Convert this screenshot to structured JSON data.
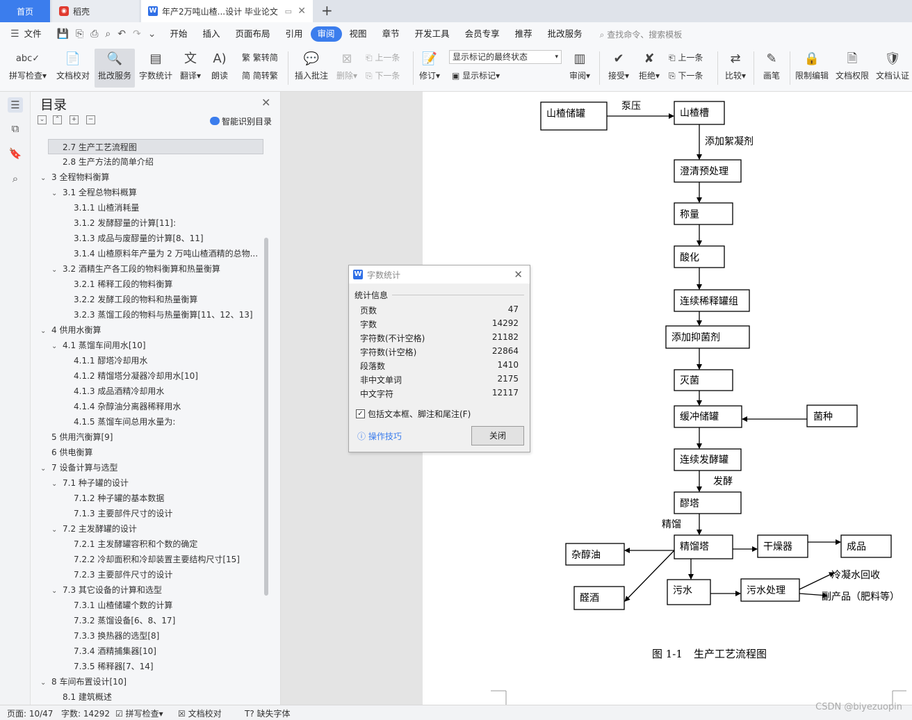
{
  "tabs": {
    "home": "首页",
    "daoke": "稻壳",
    "doc": "年产2万吨山楂...设计 毕业论文",
    "add": "+"
  },
  "menu": {
    "file": "文件",
    "items": [
      "开始",
      "插入",
      "页面布局",
      "引用",
      "审阅",
      "视图",
      "章节",
      "开发工具",
      "会员专享",
      "推荐",
      "批改服务"
    ],
    "active_index": 4,
    "search": "查找命令、搜索模板"
  },
  "ribbon": {
    "spell": "拼写检查",
    "proof": "文档校对",
    "grading": "批改服务",
    "wordcount": "字数统计",
    "translate": "翻译",
    "read": "朗读",
    "trad": "繁转简",
    "simp": "简转繁",
    "insert_comment": "插入批注",
    "delete": "删除",
    "prev": "上一条",
    "next": "下一条",
    "revise": "修订",
    "markup_state": "显示标记的最终状态",
    "show_markup": "显示标记",
    "review": "审阅",
    "accept": "接受",
    "reject": "拒绝",
    "prev2": "上一条",
    "next2": "下一条",
    "compare": "比较",
    "pen": "画笔",
    "restrict": "限制编辑",
    "permission": "文档权限",
    "certify": "文档认证"
  },
  "toc": {
    "title": "目录",
    "ai": "智能识别目录",
    "items": [
      {
        "text": "2.7 生产工艺流程图",
        "level": 2,
        "arrow": "",
        "selected": true
      },
      {
        "text": "2.8 生产方法的简单介绍",
        "level": 2,
        "arrow": ""
      },
      {
        "text": "3 全程物料衡算",
        "level": 1,
        "arrow": "v"
      },
      {
        "text": "3.1 全程总物料概算",
        "level": 2,
        "arrow": "v"
      },
      {
        "text": "3.1.1 山楂消耗量",
        "level": 3,
        "arrow": ""
      },
      {
        "text": "3.1.2 发酵醪量的计算[11]:",
        "level": 3,
        "arrow": ""
      },
      {
        "text": "3.1.3 成品与废醪量的计算[8、11]",
        "level": 3,
        "arrow": ""
      },
      {
        "text": "3.1.4 山楂原料年产量为 2 万吨山楂酒精的总物...",
        "level": 3,
        "arrow": ""
      },
      {
        "text": "3.2 酒精生产各工段的物料衡算和热量衡算",
        "level": 2,
        "arrow": "v"
      },
      {
        "text": "3.2.1 稀释工段的物料衡算",
        "level": 3,
        "arrow": ""
      },
      {
        "text": "3.2.2 发酵工段的物料和热量衡算",
        "level": 3,
        "arrow": ""
      },
      {
        "text": "3.2.3 蒸馏工段的物料与热量衡算[11、12、13]",
        "level": 3,
        "arrow": ""
      },
      {
        "text": "4 供用水衡算",
        "level": 1,
        "arrow": "v"
      },
      {
        "text": "4.1 蒸馏车间用水[10]",
        "level": 2,
        "arrow": "v"
      },
      {
        "text": "4.1.1 醪塔冷却用水",
        "level": 3,
        "arrow": ""
      },
      {
        "text": "4.1.2 精馏塔分凝器冷却用水[10]",
        "level": 3,
        "arrow": ""
      },
      {
        "text": "4.1.3 成品酒精冷却用水",
        "level": 3,
        "arrow": ""
      },
      {
        "text": "4.1.4 杂醇油分离器稀释用水",
        "level": 3,
        "arrow": ""
      },
      {
        "text": "4.1.5 蒸馏车间总用水量为:",
        "level": 3,
        "arrow": ""
      },
      {
        "text": "5 供用汽衡算[9]",
        "level": 1,
        "arrow": ""
      },
      {
        "text": "6 供电衡算",
        "level": 1,
        "arrow": ""
      },
      {
        "text": "7 设备计算与选型",
        "level": 1,
        "arrow": "v"
      },
      {
        "text": "7.1 种子罐的设计",
        "level": 2,
        "arrow": "v"
      },
      {
        "text": "7.1.2 种子罐的基本数据",
        "level": 3,
        "arrow": ""
      },
      {
        "text": "7.1.3 主要部件尺寸的设计",
        "level": 3,
        "arrow": ""
      },
      {
        "text": "7.2 主发酵罐的设计",
        "level": 2,
        "arrow": "v"
      },
      {
        "text": "7.2.1 主发酵罐容积和个数的确定",
        "level": 3,
        "arrow": ""
      },
      {
        "text": "7.2.2 冷却面积和冷却装置主要结构尺寸[15]",
        "level": 3,
        "arrow": ""
      },
      {
        "text": "7.2.3 主要部件尺寸的设计",
        "level": 3,
        "arrow": ""
      },
      {
        "text": "7.3 其它设备的计算和选型",
        "level": 2,
        "arrow": "v"
      },
      {
        "text": "7.3.1 山楂储罐个数的计算",
        "level": 3,
        "arrow": ""
      },
      {
        "text": "7.3.2 蒸馏设备[6、8、17]",
        "level": 3,
        "arrow": ""
      },
      {
        "text": "7.3.3 换热器的选型[8]",
        "level": 3,
        "arrow": ""
      },
      {
        "text": "7.3.4 酒精捕集器[10]",
        "level": 3,
        "arrow": ""
      },
      {
        "text": "7.3.5 稀释器[7、14]",
        "level": 3,
        "arrow": ""
      },
      {
        "text": "8 车间布置设计[10]",
        "level": 1,
        "arrow": "v"
      },
      {
        "text": "8.1 建筑概述",
        "level": 2,
        "arrow": ""
      }
    ]
  },
  "flow": {
    "storage": "山楂储罐",
    "pump": "泵压",
    "tank": "山楂槽",
    "flocculant": "添加絮凝剂",
    "clarify": "澄清预处理",
    "weigh": "称量",
    "acidify": "酸化",
    "dilute": "连续稀释罐组",
    "antibac": "添加抑菌剂",
    "sterilize": "灭菌",
    "buffer": "缓冲储罐",
    "strain": "菌种",
    "ferment_tank": "连续发酵罐",
    "ferment": "发酵",
    "mash_tower": "醪塔",
    "rectify": "精馏",
    "rectify_tower": "精馏塔",
    "dryer": "干燥器",
    "product": "成品",
    "fusel": "杂醇油",
    "aldehyde": "醛酒",
    "sewage": "污水",
    "sewage_treat": "污水处理",
    "cond_water": "冷凝水回收",
    "byproduct": "副产品（肥料等）",
    "caption_num": "图 1-1",
    "caption": "生产工艺流程图"
  },
  "dialog": {
    "title": "字数统计",
    "section": "统计信息",
    "rows": [
      {
        "label": "页数",
        "value": "47"
      },
      {
        "label": "字数",
        "value": "14292"
      },
      {
        "label": "字符数(不计空格)",
        "value": "21182"
      },
      {
        "label": "字符数(计空格)",
        "value": "22864"
      },
      {
        "label": "段落数",
        "value": "1410"
      },
      {
        "label": "非中文单词",
        "value": "2175"
      },
      {
        "label": "中文字符",
        "value": "12117"
      }
    ],
    "include": "包括文本框、脚注和尾注(F)",
    "tips": "操作技巧",
    "close": "关闭"
  },
  "status": {
    "page": "页面: 10/47",
    "words": "字数: 14292",
    "spell": "拼写检查",
    "proof": "文档校对",
    "fonts": "缺失字体",
    "watermark": "CSDN @biyezuopin"
  },
  "colors": {
    "accent": "#3b7ded",
    "daoke": "#e03a2f"
  }
}
